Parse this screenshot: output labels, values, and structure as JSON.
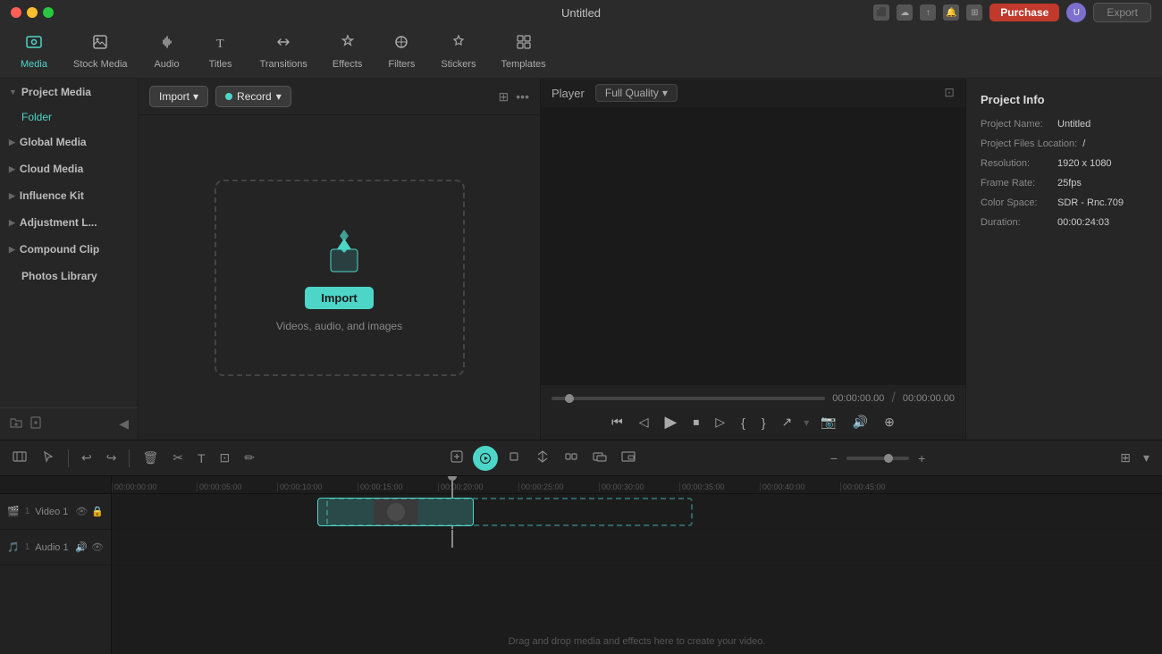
{
  "titlebar": {
    "title": "Untitled",
    "purchase_label": "Purchase",
    "export_label": "Export",
    "avatar_initial": "U"
  },
  "toolbar": {
    "items": [
      {
        "id": "media",
        "label": "Media",
        "icon": "🎞",
        "active": true
      },
      {
        "id": "stock-media",
        "label": "Stock Media",
        "icon": "📷",
        "active": false
      },
      {
        "id": "audio",
        "label": "Audio",
        "icon": "🎵",
        "active": false
      },
      {
        "id": "titles",
        "label": "Titles",
        "icon": "T",
        "active": false
      },
      {
        "id": "transitions",
        "label": "Transitions",
        "icon": "↔",
        "active": false
      },
      {
        "id": "effects",
        "label": "Effects",
        "icon": "✨",
        "active": false
      },
      {
        "id": "filters",
        "label": "Filters",
        "icon": "🎨",
        "active": false
      },
      {
        "id": "stickers",
        "label": "Stickers",
        "icon": "⭐",
        "active": false
      },
      {
        "id": "templates",
        "label": "Templates",
        "icon": "⊞",
        "active": false
      }
    ]
  },
  "sidebar": {
    "sections": [
      {
        "id": "project-media",
        "label": "Project Media",
        "expanded": true,
        "sub_items": [
          "Folder"
        ]
      },
      {
        "id": "global-media",
        "label": "Global Media",
        "expanded": false
      },
      {
        "id": "cloud-media",
        "label": "Cloud Media",
        "expanded": false
      },
      {
        "id": "influence-kit",
        "label": "Influence Kit",
        "expanded": false
      },
      {
        "id": "adjustment-l",
        "label": "Adjustment L...",
        "expanded": false
      },
      {
        "id": "compound-clip",
        "label": "Compound Clip",
        "expanded": false
      },
      {
        "id": "photos-library",
        "label": "Photos Library",
        "no_arrow": true
      }
    ]
  },
  "media": {
    "import_label": "Import",
    "record_label": "Record",
    "drop_zone": {
      "import_btn_label": "Import",
      "helper_text": "Videos, audio, and images"
    }
  },
  "player": {
    "label": "Player",
    "quality_label": "Full Quality",
    "time_current": "00:00:00.00",
    "time_total": "00:00:00.00",
    "time_separator": "/"
  },
  "project_info": {
    "title": "Project Info",
    "rows": [
      {
        "label": "Project Name:",
        "value": "Untitled"
      },
      {
        "label": "Project Files Location:",
        "value": "/"
      },
      {
        "label": "Resolution:",
        "value": "1920 x 1080"
      },
      {
        "label": "Frame Rate:",
        "value": "25fps"
      },
      {
        "label": "Color Space:",
        "value": "SDR - Rnc.709"
      },
      {
        "label": "Duration:",
        "value": "00:00:24:03"
      }
    ]
  },
  "timeline": {
    "ruler_ticks": [
      "00:00:00:00",
      "00:00:05:00",
      "00:00:10:00",
      "00:00:15:00",
      "00:00:20:00",
      "00:00:25:00",
      "00:00:30:00",
      "00:00:35:00",
      "00:00:40:00",
      "00:00:45:00"
    ],
    "tracks": [
      {
        "id": "video-1",
        "label": "Video 1"
      },
      {
        "id": "audio-1",
        "label": "Audio 1"
      }
    ],
    "drag_drop_hint": "Drag and drop media and effects here to create your video."
  }
}
